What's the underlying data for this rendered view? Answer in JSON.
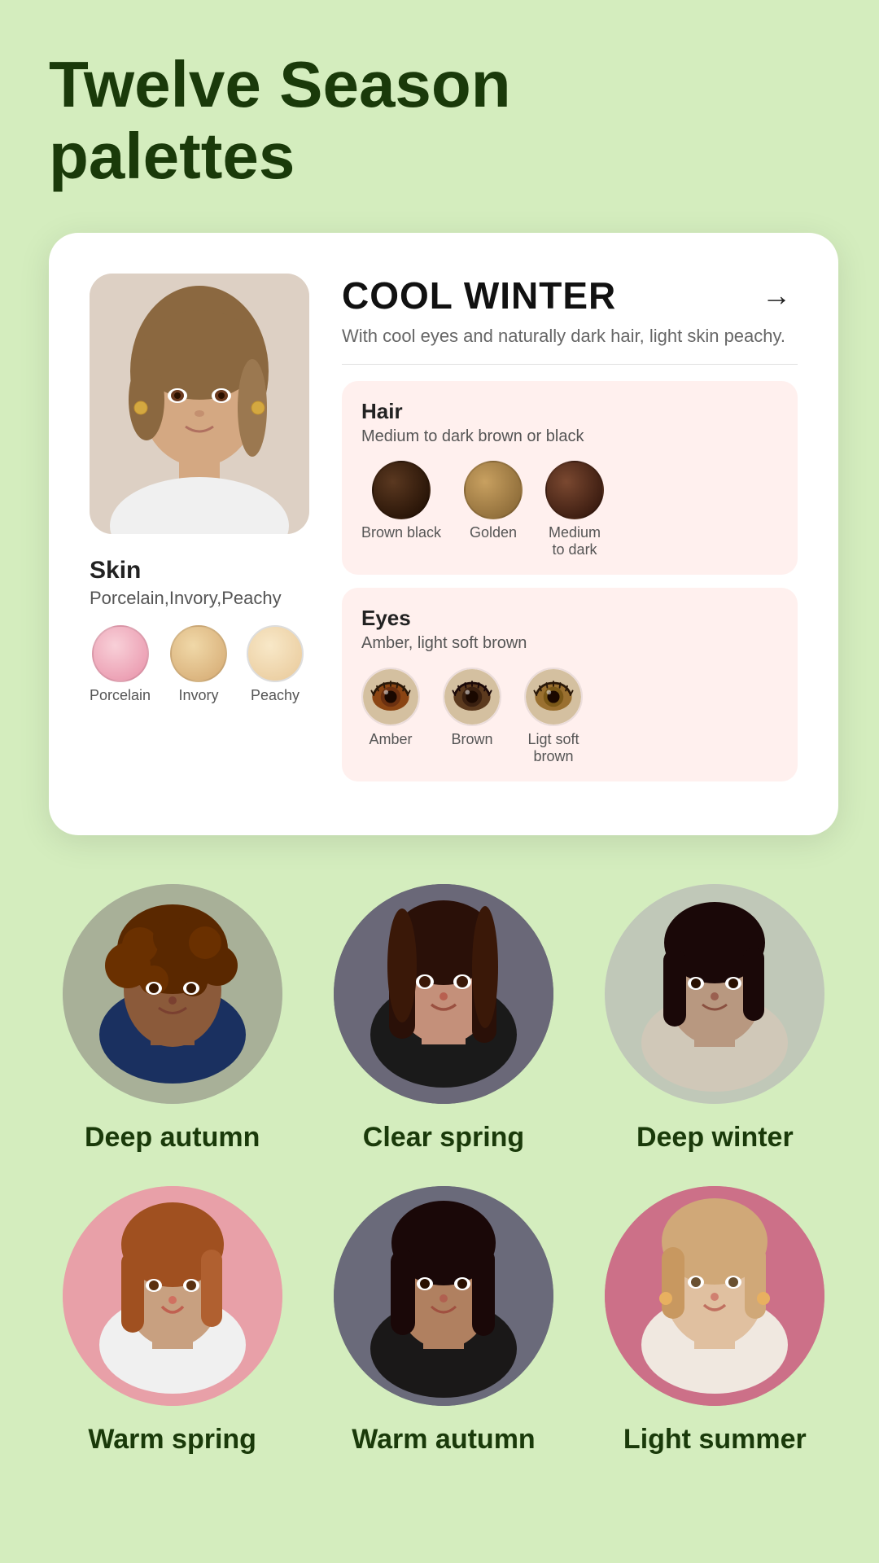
{
  "title": "Twelve Season\npalettes",
  "card": {
    "season": "COOL WINTER",
    "description": "With cool eyes and naturally dark hair,\nlight skin peachy.",
    "arrow": "→",
    "skin": {
      "label": "Skin",
      "subtitle": "Porcelain,Invory,Peachy",
      "swatches": [
        {
          "name": "Porcelain",
          "color": "#f0a8b8"
        },
        {
          "name": "Invory",
          "color": "#e8c898"
        },
        {
          "name": "Peachy",
          "color": "#f0d8b8"
        }
      ]
    },
    "hair": {
      "label": "Hair",
      "subtitle": "Medium to dark brown or black",
      "swatches": [
        {
          "name": "Brown black",
          "color": "#3a2010"
        },
        {
          "name": "Golden",
          "color": "#a88040"
        },
        {
          "name": "Medium\nto dark",
          "color": "#5a3020"
        }
      ]
    },
    "eyes": {
      "label": "Eyes",
      "subtitle": "Amber, light soft brown",
      "swatches": [
        {
          "name": "Amber",
          "color": "#8b4513",
          "iris": "#a0522d"
        },
        {
          "name": "Brown",
          "color": "#5c3a1e",
          "iris": "#7b4f2e"
        },
        {
          "name": "Ligt soft\nbrown",
          "color": "#8b6914",
          "iris": "#a0802a"
        }
      ]
    }
  },
  "people": [
    {
      "name": "Deep autumn",
      "bg": "#b0b8a0",
      "skin": "#8B5A3A",
      "hair": "#5A2800"
    },
    {
      "name": "Clear spring",
      "bg": "#6a6878",
      "skin": "#C4907A",
      "hair": "#3a2010"
    },
    {
      "name": "Deep winter",
      "bg": "#c0c8c0",
      "skin": "#B89880",
      "hair": "#2a1808"
    },
    {
      "name": "Warm spring",
      "bg": "#e8a0a8",
      "skin": "#C8A080",
      "hair": "#A05020"
    },
    {
      "name": "Warm autumn",
      "bg": "#7a7a8a",
      "skin": "#B08060",
      "hair": "#2a1808"
    },
    {
      "name": "Light summer",
      "bg": "#cc6888",
      "skin": "#E0C0A0",
      "hair": "#D0A878"
    }
  ]
}
